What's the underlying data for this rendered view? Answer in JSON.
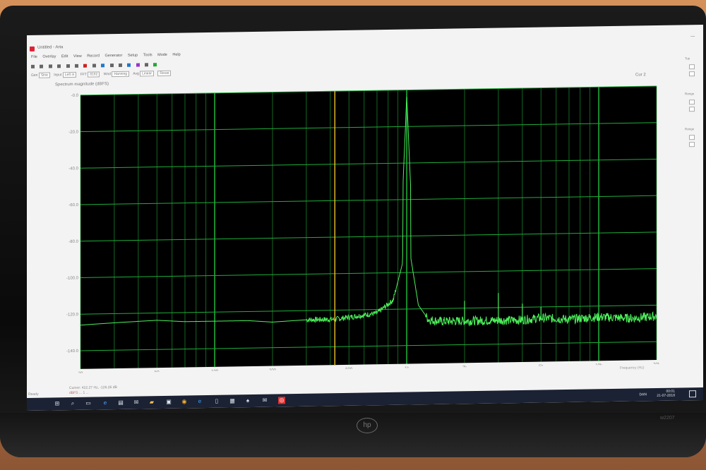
{
  "window": {
    "title": "Untitled - Arta",
    "minimize_icon": "minimize-icon"
  },
  "menu": [
    "File",
    "Overlay",
    "Edit",
    "View",
    "Record",
    "Generator",
    "Setup",
    "Tools",
    "Mode",
    "Help"
  ],
  "options": {
    "gen_label": "Gen",
    "gen_value": "Sine",
    "input_label": "Input",
    "input_value": "Left in",
    "fft_label": "FFT",
    "fft_value": "8192",
    "win_label": "Wnd",
    "win_value": "Hanning",
    "avg_label": "Avg",
    "avg_value": "Linear",
    "reset_label": "Reset"
  },
  "plot": {
    "title": "Spectrum magnitude (dBFS)",
    "corner_label": "Cur 2",
    "y_ticks": [
      "-0.0",
      "-20.0",
      "-40.0",
      "-60.0",
      "-80.0",
      "-100.0",
      "-120.0",
      "-140.0"
    ],
    "x_ticks": [
      "20",
      "50",
      "100",
      "200",
      "500",
      "1k",
      "2k",
      "5k",
      "10k",
      "20k"
    ],
    "x_axis_label": "Frequency (Hz)",
    "cursor_line_color": "#f0c22a",
    "trace_color": "#4cf05a",
    "grid_color": "#1fae3a",
    "background_color": "#000000"
  },
  "status": {
    "cursor_text": "Cursor: 422.27 Hz, -126.26 dB",
    "secondary_text": "dBFS ... 1 ...",
    "ready_text": "Ready"
  },
  "right_panel": {
    "labels": [
      "Top",
      "Range",
      "Range",
      "Range"
    ]
  },
  "taskbar": {
    "time": "00:01",
    "date": "21-07-2018",
    "lang": "DAN",
    "icons": [
      "windows-icon",
      "search-icon",
      "taskview-icon",
      "edge-icon",
      "explorer-icon",
      "mail-icon",
      "folder-icon",
      "store-icon",
      "chrome-icon",
      "ie-icon",
      "notepad-icon",
      "calendar-icon",
      "solitaire-icon",
      "mail2-icon",
      "arta-icon"
    ]
  },
  "monitor": {
    "brand": "hp",
    "model": "w2207"
  },
  "chart_data": {
    "type": "line",
    "title": "Spectrum magnitude (dBFS)",
    "xlabel": "Frequency (Hz)",
    "ylabel": "",
    "xscale": "log",
    "xlim": [
      20,
      20000
    ],
    "ylim": [
      -150,
      0
    ],
    "grid": true,
    "series": [
      {
        "x": [
          20,
          30,
          50,
          70,
          100,
          150,
          200,
          300,
          422,
          500,
          700,
          850,
          950,
          1000,
          1050,
          1150,
          1300,
          1500,
          2000,
          2500,
          3000,
          4000,
          5000,
          7000,
          10000,
          15000,
          20000
        ],
        "y": [
          -126,
          -125,
          -124,
          -125,
          -125,
          -125,
          -126,
          -125,
          -125,
          -124,
          -122,
          -115,
          -95,
          -3,
          -92,
          -118,
          -126,
          -127,
          -127,
          -127,
          -127,
          -127,
          -126,
          -127,
          -126,
          -127,
          -126
        ]
      }
    ],
    "spikes": [
      {
        "x": 2000,
        "y": -116
      },
      {
        "x": 3000,
        "y": -112
      },
      {
        "x": 4000,
        "y": -118
      },
      {
        "x": 5000,
        "y": -120
      }
    ],
    "cursor_x": 422.27,
    "cursor_y": -126.26
  }
}
